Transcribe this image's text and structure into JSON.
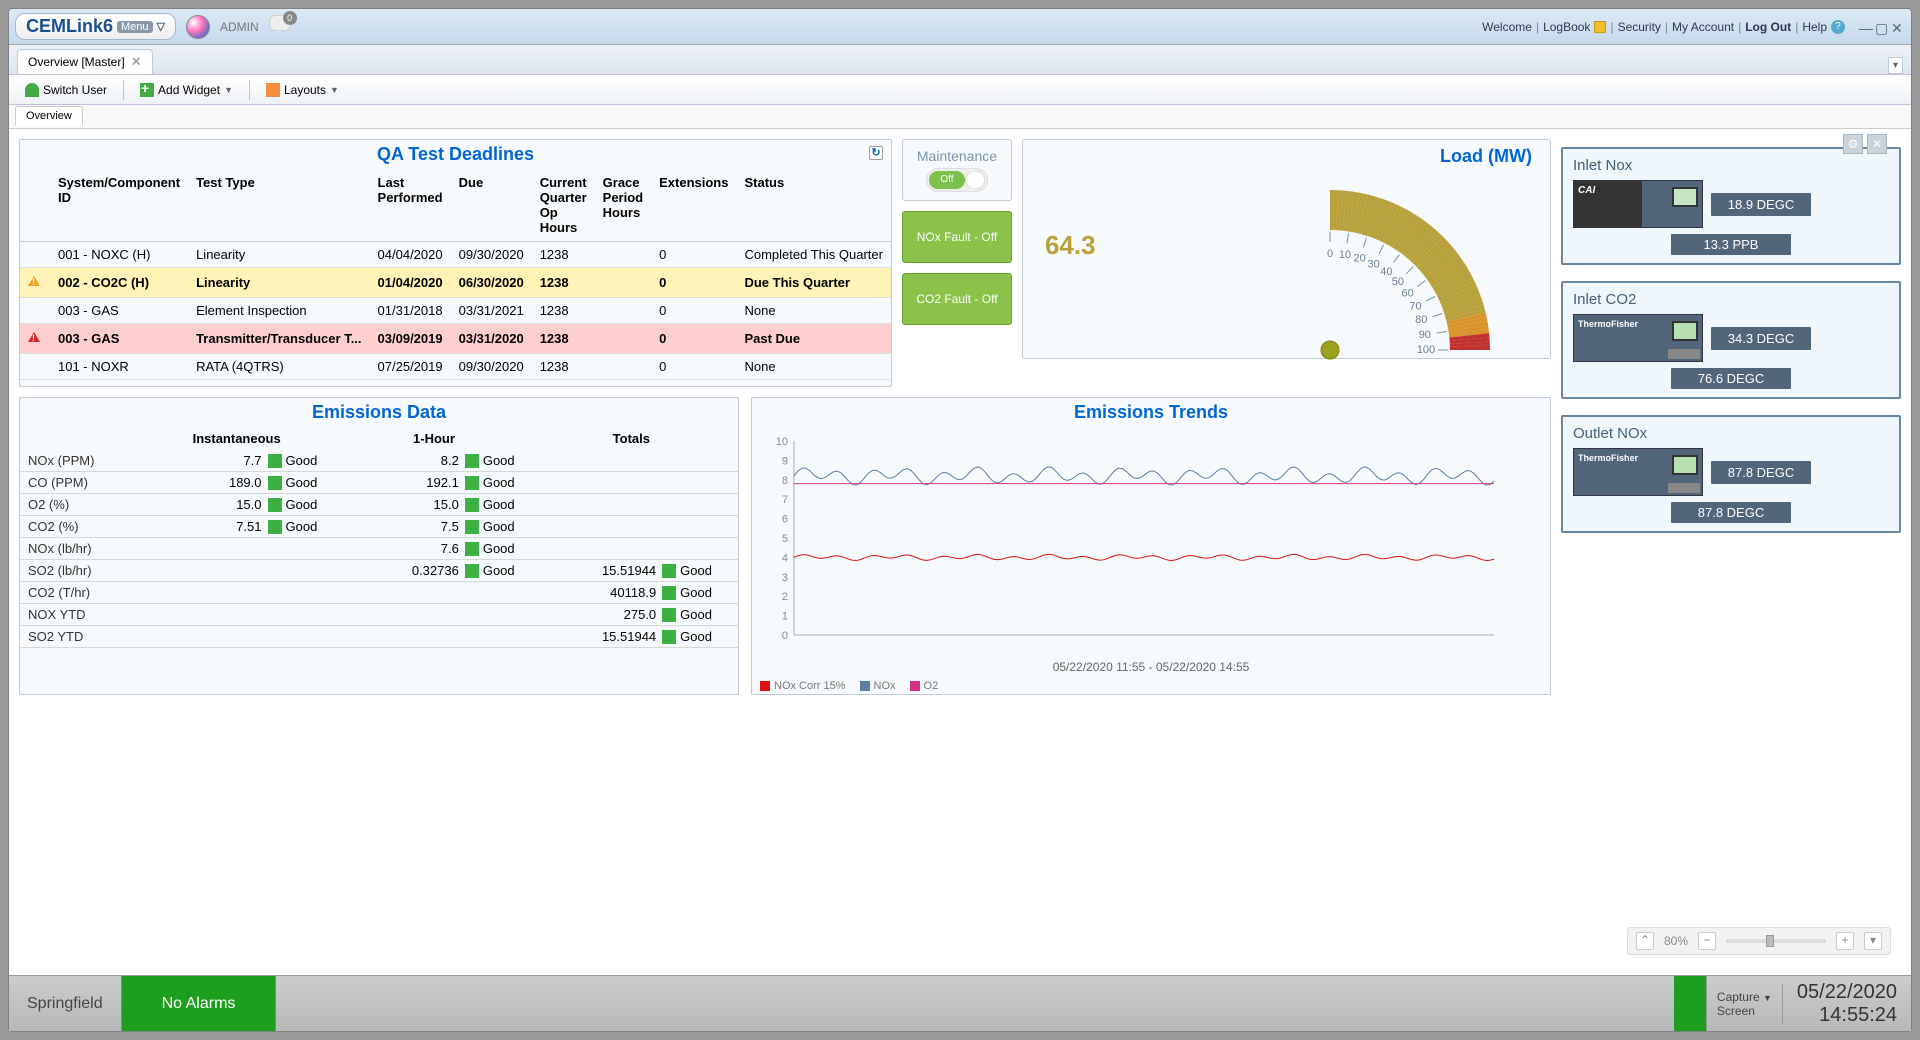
{
  "titlebar": {
    "logo_main": "CEMLink6",
    "logo_sub": "Menu",
    "user": "ADMIN",
    "chat_badge": "0",
    "welcome": "Welcome",
    "logbook": "LogBook",
    "security": "Security",
    "account": "My Account",
    "logout": "Log Out",
    "help": "Help"
  },
  "window_tab": {
    "title": "Overview [Master]"
  },
  "toolbar": {
    "switch": "Switch User",
    "add": "Add Widget",
    "layouts": "Layouts"
  },
  "content_tab": "Overview",
  "qa": {
    "title": "QA Test Deadlines",
    "cols": [
      "System/Component ID",
      "Test Type",
      "Last Performed",
      "Due",
      "Current Quarter Op Hours",
      "Grace Period Hours",
      "Extensions",
      "Status"
    ],
    "rows": [
      {
        "mark": "",
        "id": "001 - NOXC (H)",
        "test": "Linearity",
        "last": "04/04/2020",
        "due": "09/30/2020",
        "op": "1238",
        "grace": "",
        "ext": "0",
        "status": "Completed This Quarter"
      },
      {
        "mark": "warn",
        "id": "002 - CO2C (H)",
        "test": "Linearity",
        "last": "01/04/2020",
        "due": "06/30/2020",
        "op": "1238",
        "grace": "",
        "ext": "0",
        "status": "Due This Quarter",
        "bold": true
      },
      {
        "mark": "",
        "id": "003 - GAS",
        "test": "Element Inspection",
        "last": "01/31/2018",
        "due": "03/31/2021",
        "op": "1238",
        "grace": "",
        "ext": "0",
        "status": "None"
      },
      {
        "mark": "err",
        "id": "003 - GAS",
        "test": "Transmitter/Transducer T...",
        "last": "03/09/2019",
        "due": "03/31/2020",
        "op": "1238",
        "grace": "",
        "ext": "0",
        "status": "Past Due",
        "bold": true
      },
      {
        "mark": "",
        "id": "101 - NOXR",
        "test": "RATA (4QTRS)",
        "last": "07/25/2019",
        "due": "09/30/2020",
        "op": "1238",
        "grace": "",
        "ext": "0",
        "status": "None"
      }
    ]
  },
  "maint": {
    "label": "Maintenance",
    "on": "Off"
  },
  "faults": {
    "nox": "NOx Fault - Off",
    "co2": "CO2 Fault - Off"
  },
  "gauge": {
    "title": "Load (MW)",
    "value": "64.3",
    "ticks": [
      "0",
      "10",
      "20",
      "30",
      "40",
      "50",
      "60",
      "70",
      "80",
      "90",
      "100"
    ]
  },
  "emdata": {
    "title": "Emissions Data",
    "heads": [
      "",
      "Instantaneous",
      "1-Hour",
      "Totals"
    ],
    "rows": [
      {
        "label": "NOx (PPM)",
        "inst": "7.7",
        "instG": "Good",
        "hr": "8.2",
        "hrG": "Good",
        "tot": "",
        "totG": ""
      },
      {
        "label": "CO (PPM)",
        "inst": "189.0",
        "instG": "Good",
        "hr": "192.1",
        "hrG": "Good",
        "tot": "",
        "totG": ""
      },
      {
        "label": "O2 (%)",
        "inst": "15.0",
        "instG": "Good",
        "hr": "15.0",
        "hrG": "Good",
        "tot": "",
        "totG": ""
      },
      {
        "label": "CO2 (%)",
        "inst": "7.51",
        "instG": "Good",
        "hr": "7.5",
        "hrG": "Good",
        "tot": "",
        "totG": ""
      },
      {
        "label": "NOx (lb/hr)",
        "inst": "",
        "instG": "",
        "hr": "7.6",
        "hrG": "Good",
        "tot": "",
        "totG": ""
      },
      {
        "label": "SO2 (lb/hr)",
        "inst": "",
        "instG": "",
        "hr": "0.32736",
        "hrG": "Good",
        "tot": "15.51944",
        "totG": "Good"
      },
      {
        "label": "CO2 (T/hr)",
        "inst": "",
        "instG": "",
        "hr": "",
        "hrG": "",
        "tot": "40118.9",
        "totG": "Good"
      },
      {
        "label": "NOX YTD",
        "inst": "",
        "instG": "",
        "hr": "",
        "hrG": "",
        "tot": "275.0",
        "totG": "Good"
      },
      {
        "label": "SO2 YTD",
        "inst": "",
        "instG": "",
        "hr": "",
        "hrG": "",
        "tot": "15.51944",
        "totG": "Good"
      }
    ]
  },
  "trends": {
    "title": "Emissions Trends",
    "xlabel": "05/22/2020 11:55 - 05/22/2020 14:55",
    "legend": [
      {
        "name": "NOx Corr 15%",
        "color": "#d11"
      },
      {
        "name": "NOx",
        "color": "#5a7fa6"
      },
      {
        "name": "O2",
        "color": "#d63384"
      }
    ]
  },
  "chart_data": {
    "type": "line",
    "title": "Emissions Trends",
    "xlabel": "05/22/2020 11:55 - 05/22/2020 14:55",
    "ylim": [
      0,
      10
    ],
    "yticks": [
      0,
      1,
      2,
      3,
      4,
      5,
      6,
      7,
      8,
      9,
      10
    ],
    "series": [
      {
        "name": "NOx Corr 15%",
        "color": "#d11",
        "approx_level": 4.0,
        "amplitude": 0.1
      },
      {
        "name": "NOx",
        "color": "#5a7fa6",
        "approx_level": 8.2,
        "amplitude": 0.3
      },
      {
        "name": "O2",
        "color": "#d63384",
        "approx_level": 7.8,
        "flat": true
      }
    ]
  },
  "instr": {
    "inlet_nox": {
      "title": "Inlet Nox",
      "brand": "CAI",
      "r1": "18.9 DEGC",
      "r2": "13.3 PPB"
    },
    "inlet_co2": {
      "title": "Inlet CO2",
      "brand": "ThermoFisher",
      "r1": "34.3 DEGC",
      "r2": "76.6 DEGC"
    },
    "outlet_nox": {
      "title": "Outlet NOx",
      "brand": "ThermoFisher",
      "r1": "87.8 DEGC",
      "r2": "87.8 DEGC"
    }
  },
  "zoom": {
    "value": "80%"
  },
  "statusbar": {
    "site": "Springfield",
    "alarm": "No Alarms",
    "capture": "Capture",
    "capture2": "Screen",
    "date": "05/22/2020",
    "time": "14:55:24"
  }
}
